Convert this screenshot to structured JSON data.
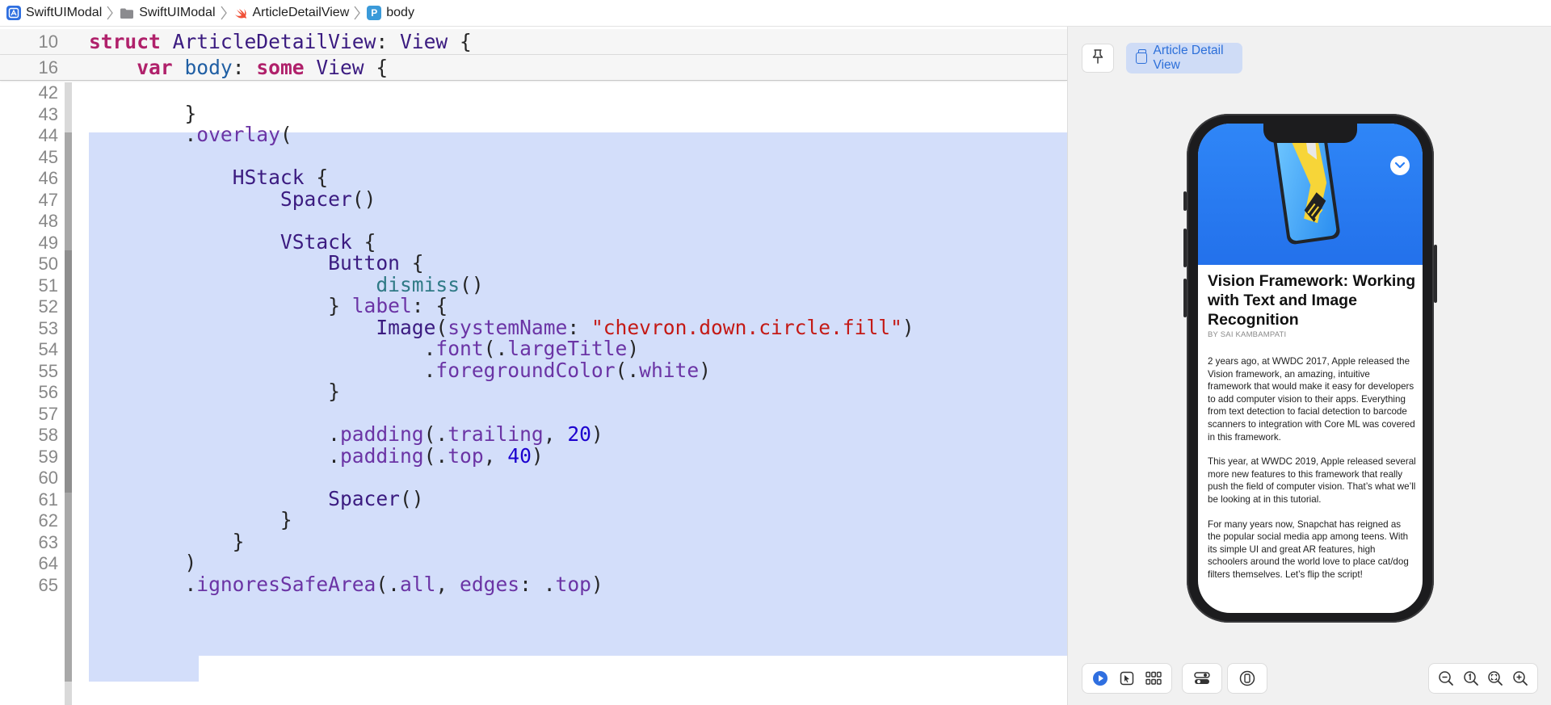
{
  "breadcrumb": [
    {
      "label": "SwiftUIModal",
      "icon": "project-icon"
    },
    {
      "label": "SwiftUIModal",
      "icon": "folder-icon"
    },
    {
      "label": "ArticleDetailView",
      "icon": "swift-file-icon"
    },
    {
      "label": "body",
      "icon": "property-icon",
      "icon_letter": "P"
    }
  ],
  "editor": {
    "sticky_lines": [
      {
        "num": "10",
        "tokens": [
          [
            "kw",
            "struct"
          ],
          [
            "pl",
            " "
          ],
          [
            "ty",
            "ArticleDetailView"
          ],
          [
            "pl",
            ": "
          ],
          [
            "ty",
            "View"
          ],
          [
            "pl",
            " {"
          ]
        ]
      },
      {
        "num": "16",
        "tokens": [
          [
            "pl",
            "    "
          ],
          [
            "kw",
            "var"
          ],
          [
            "pl",
            " "
          ],
          [
            "tyb",
            "body"
          ],
          [
            "pl",
            ": "
          ],
          [
            "kw",
            "some"
          ],
          [
            "pl",
            " "
          ],
          [
            "ty",
            "View"
          ],
          [
            "pl",
            " {"
          ]
        ]
      }
    ],
    "lines": [
      {
        "num": "42",
        "tokens": []
      },
      {
        "num": "43",
        "tokens": [
          [
            "pl",
            "        }"
          ]
        ]
      },
      {
        "num": "44",
        "tokens": [
          [
            "pl",
            "        ."
          ],
          [
            "me",
            "overlay"
          ],
          [
            "pl",
            "("
          ]
        ]
      },
      {
        "num": "45",
        "tokens": []
      },
      {
        "num": "46",
        "tokens": [
          [
            "pl",
            "            "
          ],
          [
            "ty",
            "HStack"
          ],
          [
            "pl",
            " {"
          ]
        ]
      },
      {
        "num": "47",
        "tokens": [
          [
            "pl",
            "                "
          ],
          [
            "ty",
            "Spacer"
          ],
          [
            "pl",
            "()"
          ]
        ]
      },
      {
        "num": "48",
        "tokens": []
      },
      {
        "num": "49",
        "tokens": [
          [
            "pl",
            "                "
          ],
          [
            "ty",
            "VStack"
          ],
          [
            "pl",
            " {"
          ]
        ]
      },
      {
        "num": "50",
        "tokens": [
          [
            "pl",
            "                    "
          ],
          [
            "ty",
            "Button"
          ],
          [
            "pl",
            " {"
          ]
        ]
      },
      {
        "num": "51",
        "tokens": [
          [
            "pl",
            "                        "
          ],
          [
            "fn",
            "dismiss"
          ],
          [
            "pl",
            "()"
          ]
        ]
      },
      {
        "num": "52",
        "tokens": [
          [
            "pl",
            "                    } "
          ],
          [
            "me",
            "label"
          ],
          [
            "pl",
            ": {"
          ]
        ]
      },
      {
        "num": "53",
        "tokens": [
          [
            "pl",
            "                        "
          ],
          [
            "ty",
            "Image"
          ],
          [
            "pl",
            "("
          ],
          [
            "me",
            "systemName"
          ],
          [
            "pl",
            ": "
          ],
          [
            "st",
            "\"chevron.down.circle.fill\""
          ],
          [
            "pl",
            ")"
          ]
        ]
      },
      {
        "num": "54",
        "tokens": [
          [
            "pl",
            "                            ."
          ],
          [
            "me",
            "font"
          ],
          [
            "pl",
            "(."
          ],
          [
            "me",
            "largeTitle"
          ],
          [
            "pl",
            ")"
          ]
        ]
      },
      {
        "num": "55",
        "tokens": [
          [
            "pl",
            "                            ."
          ],
          [
            "me",
            "foregroundColor"
          ],
          [
            "pl",
            "(."
          ],
          [
            "me",
            "white"
          ],
          [
            "pl",
            ")"
          ]
        ]
      },
      {
        "num": "56",
        "tokens": [
          [
            "pl",
            "                    }"
          ]
        ]
      },
      {
        "num": "57",
        "tokens": []
      },
      {
        "num": "58",
        "tokens": [
          [
            "pl",
            "                    ."
          ],
          [
            "me",
            "padding"
          ],
          [
            "pl",
            "(."
          ],
          [
            "me",
            "trailing"
          ],
          [
            "pl",
            ", "
          ],
          [
            "nu",
            "20"
          ],
          [
            "pl",
            ")"
          ]
        ]
      },
      {
        "num": "59",
        "tokens": [
          [
            "pl",
            "                    ."
          ],
          [
            "me",
            "padding"
          ],
          [
            "pl",
            "(."
          ],
          [
            "me",
            "top"
          ],
          [
            "pl",
            ", "
          ],
          [
            "nu",
            "40"
          ],
          [
            "pl",
            ")"
          ]
        ]
      },
      {
        "num": "60",
        "tokens": []
      },
      {
        "num": "61",
        "tokens": [
          [
            "pl",
            "                    "
          ],
          [
            "ty",
            "Spacer"
          ],
          [
            "pl",
            "()"
          ]
        ]
      },
      {
        "num": "62",
        "tokens": [
          [
            "pl",
            "                }"
          ]
        ]
      },
      {
        "num": "63",
        "tokens": [
          [
            "pl",
            "            }"
          ]
        ]
      },
      {
        "num": "64",
        "tokens": [
          [
            "pl",
            "        )"
          ]
        ]
      },
      {
        "num": "65",
        "tokens": [
          [
            "pl",
            "        ."
          ],
          [
            "me",
            "ignoresSafeArea"
          ],
          [
            "pl",
            "(."
          ],
          [
            "me",
            "all"
          ],
          [
            "pl",
            ", "
          ],
          [
            "me",
            "edges"
          ],
          [
            "pl",
            ": ."
          ],
          [
            "me",
            "top"
          ],
          [
            "pl",
            ")"
          ]
        ]
      }
    ],
    "selection": {
      "from_line": "44",
      "to_line": "64"
    }
  },
  "colors": {
    "keyword": "#b0216b",
    "type": "#3b1b80",
    "method": "#6b34a5",
    "string": "#c41a16",
    "number": "#1c00cf",
    "selection": "#d3defa",
    "accent": "#2c6fd9"
  },
  "canvas": {
    "variant_label": "Article Detail View",
    "pin_icon": "pin-icon"
  },
  "preview_app": {
    "title": "Vision Framework: Working with Text and Image Recognition",
    "author": "BY SAI KAMBAMPATI",
    "paragraphs": [
      "2 years ago, at WWDC 2017, Apple released the Vision framework, an amazing, intuitive framework that would make it easy for developers to add computer vision to their apps. Everything from text detection to facial detection to barcode scanners to integration with Core ML was covered in this framework.",
      "This year, at WWDC 2019, Apple released several more new features to this framework that really push the field of computer vision. That’s what we’ll be looking at in this tutorial.",
      "For many years now, Snapchat has reigned as the popular social media app among teens. With its simple UI and great AR features, high schoolers around the world love to place cat/dog filters themselves. Let’s flip the script!"
    ],
    "dismiss_icon": "chevron-down-circle-icon"
  },
  "bottom_toolbar": {
    "left_group": [
      "live-preview-icon",
      "selectable-icon",
      "variants-grid-icon"
    ],
    "device_settings": "device-settings-icon",
    "device_select": "device-icon",
    "zoom_group": [
      "zoom-out-icon",
      "zoom-100-icon",
      "zoom-fit-icon",
      "zoom-in-icon"
    ]
  }
}
